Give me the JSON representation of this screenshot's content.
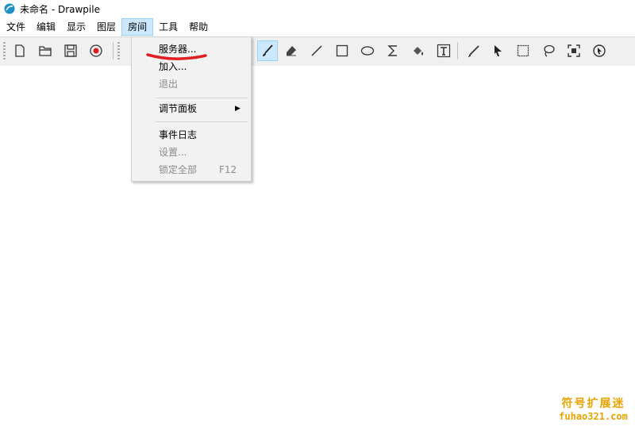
{
  "window": {
    "title": "未命名 - Drawpile"
  },
  "menubar": {
    "items": [
      {
        "label": "文件",
        "active": false
      },
      {
        "label": "编辑",
        "active": false
      },
      {
        "label": "显示",
        "active": false
      },
      {
        "label": "图层",
        "active": false
      },
      {
        "label": "房间",
        "active": true
      },
      {
        "label": "工具",
        "active": false
      },
      {
        "label": "帮助",
        "active": false
      }
    ]
  },
  "toolbar": {
    "file_tools": [
      "new-document-icon",
      "open-folder-icon",
      "save-icon",
      "record-icon"
    ],
    "draw_tools": [
      "brush-icon",
      "eraser-icon",
      "line-icon",
      "rectangle-icon",
      "ellipse-icon",
      "bezier-icon",
      "fill-icon",
      "text-icon",
      "color-picker-icon",
      "laser-pointer-icon",
      "rectangle-select-icon",
      "lasso-select-icon",
      "zoom-fit-icon",
      "inspector-icon"
    ],
    "selected_tool": "brush-icon"
  },
  "room_menu": {
    "items": [
      {
        "label": "服务器...",
        "enabled": true
      },
      {
        "label": "加入...",
        "enabled": true
      },
      {
        "label": "退出",
        "enabled": false
      },
      {
        "label": "调节面板",
        "enabled": true,
        "submenu": true
      },
      {
        "label": "事件日志",
        "enabled": true
      },
      {
        "label": "设置...",
        "enabled": false
      },
      {
        "label": "锁定全部",
        "enabled": false,
        "shortcut": "F12"
      }
    ]
  },
  "annotation": {
    "color": "#e02020"
  },
  "watermark": {
    "line1": "符号扩展迷",
    "line2": "fuhao321.com",
    "color": "#e8a400"
  },
  "colors": {
    "accent": "#cce8ff",
    "accent_border": "#99d1ff",
    "app_icon": "#1e90c8"
  }
}
